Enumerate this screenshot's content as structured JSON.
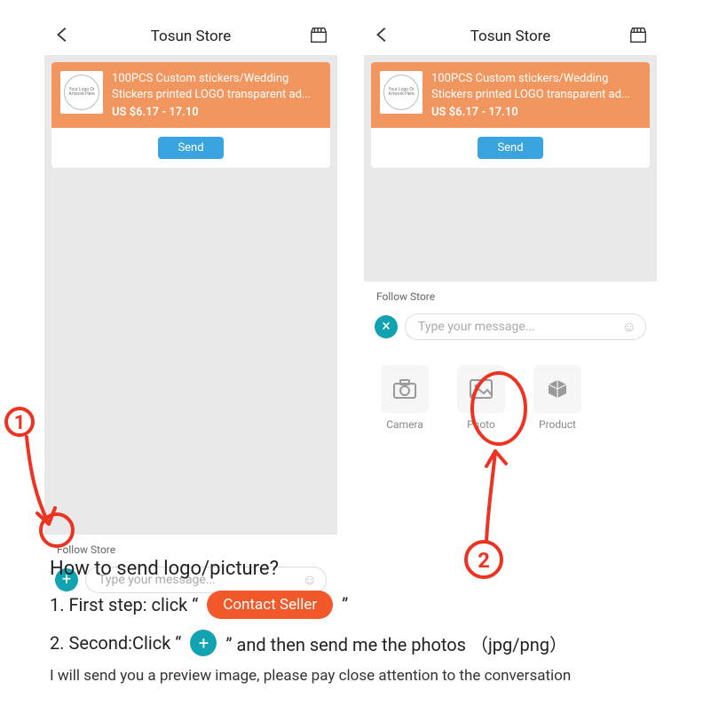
{
  "header": {
    "title": "Tosun Store"
  },
  "product": {
    "thumb_text": "Your Logo Or Artwork Here",
    "title_line1": "100PCS Custom stickers/Wedding",
    "title_line2": "Stickers printed  LOGO transparent ad...",
    "price": "US $6.17 - 17.10",
    "send_label": "Send"
  },
  "chat": {
    "follow_label": "Follow Store",
    "placeholder": "Type your message..."
  },
  "attach": {
    "camera": "Camera",
    "photo": "Photo",
    "product": "Product"
  },
  "instructions": {
    "question": "How to send logo/picture?",
    "step1_prefix": "1. First step: click “",
    "step1_button": "Contact Seller",
    "step1_suffix": "”",
    "step2_prefix": "2. Second:Click “",
    "step2_suffix": "”  and then send me the photos （jpg/png）",
    "note": "I will send you a preview image, please pay close attention to the conversation"
  },
  "anno": {
    "label1": "1",
    "label2": "2"
  }
}
